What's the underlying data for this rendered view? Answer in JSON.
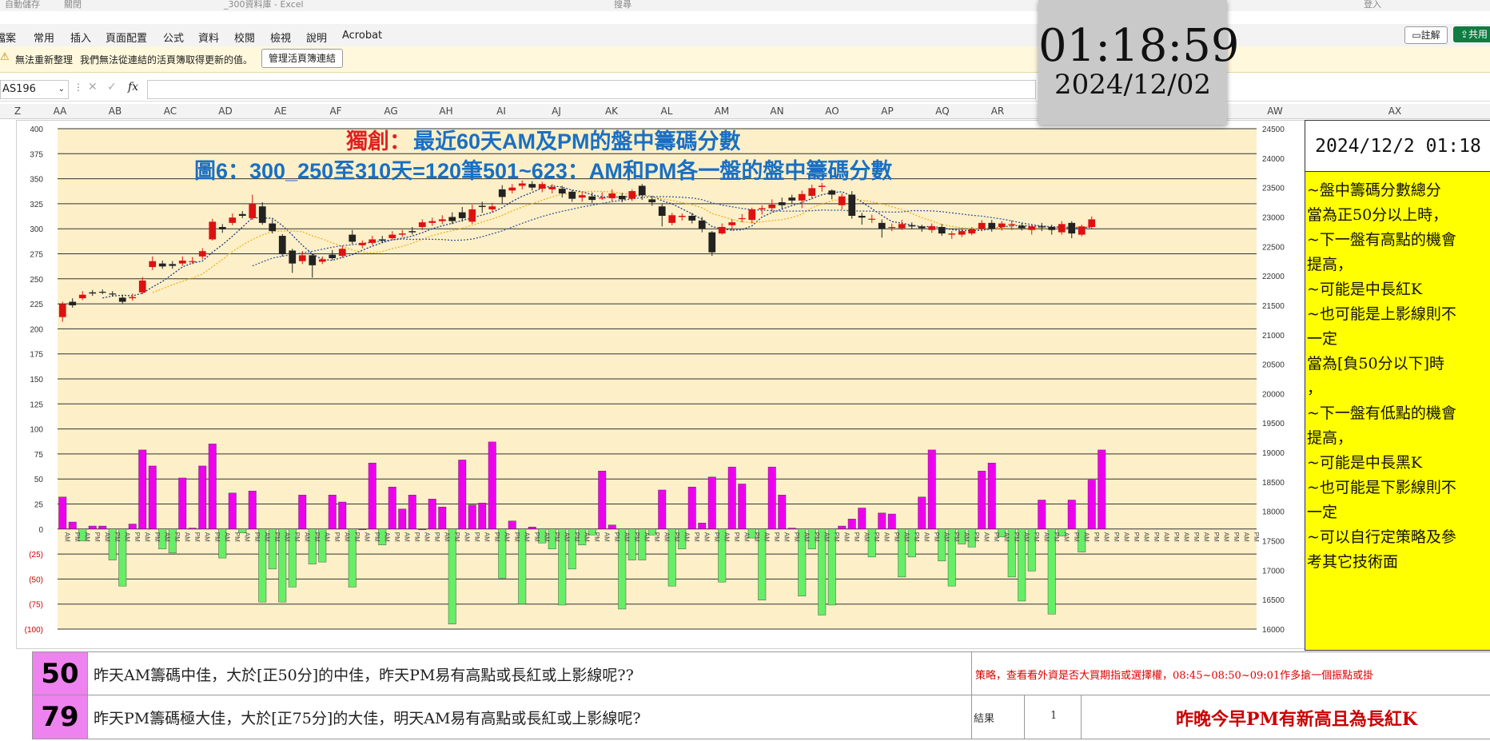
{
  "titlebar": {
    "autosave_label": "自動儲存",
    "autosave_state": "關閉",
    "filename": "_300資料庫 - Excel",
    "search_placeholder": "搜尋",
    "signin_label": "登入"
  },
  "menu": {
    "items": [
      "檔案",
      "常用",
      "插入",
      "頁面配置",
      "公式",
      "資料",
      "校閱",
      "檢視",
      "說明",
      "Acrobat"
    ],
    "comments_label": "註解",
    "share_label": "共用"
  },
  "message_bar": {
    "title": "無法重新整理",
    "text": "我們無法從連結的活頁簿取得更新的值。",
    "button_label": "管理活頁簿連結"
  },
  "formula_bar": {
    "name_box": "AS196",
    "fx_label": "fx",
    "formula": ""
  },
  "column_headers": [
    "Z",
    "AA",
    "AB",
    "AC",
    "AD",
    "AE",
    "AF",
    "AG",
    "AH",
    "AI",
    "AJ",
    "AK",
    "AL",
    "AM",
    "AN",
    "AO",
    "AP",
    "AQ",
    "AR",
    "AW",
    "AX"
  ],
  "clock": {
    "time": "01:18:59",
    "date": "2024/12/02"
  },
  "chart_data": {
    "type": "candlestick",
    "title_prefix": "獨創：",
    "title": "最近60天AM及PM的盤中籌碼分數",
    "subtitle": "圖6：300_250至310天=120筆501~623：AM和PM各一盤的盤中籌碼分數",
    "left_axis_ticks": [
      "400",
      "375",
      "350",
      "325",
      "300",
      "275",
      "250",
      "225",
      "200",
      "175",
      "150",
      "125",
      "100",
      "75",
      "50",
      "25",
      "0",
      "(25)",
      "(50)",
      "(75)",
      "(100)"
    ],
    "right_axis_ticks": [
      "24500",
      "24000",
      "23500",
      "23000",
      "22500",
      "22000",
      "21500",
      "21000",
      "20500",
      "20000",
      "19500",
      "19000",
      "18500",
      "18000",
      "17500",
      "17000",
      "16500",
      "16000"
    ],
    "ylim_left": [
      -100,
      400
    ],
    "ylim_right": [
      16000,
      24500
    ],
    "grid": true,
    "scores": [
      32,
      7,
      -12,
      3,
      3,
      -31,
      -57,
      5,
      79,
      63,
      -20,
      -24,
      51,
      1,
      63,
      85,
      -29,
      36,
      -4,
      38,
      -73,
      -40,
      -73,
      -58,
      34,
      -35,
      -33,
      34,
      27,
      -58,
      0,
      66,
      -16,
      42,
      20,
      34,
      0,
      30,
      22,
      -95,
      69,
      24,
      26,
      87,
      -49,
      8,
      -75,
      2,
      -14,
      -20,
      -76,
      -40,
      -16,
      -6,
      58,
      4,
      -80,
      -31,
      -31,
      -6,
      39,
      -57,
      -20,
      42,
      6,
      52,
      -53,
      62,
      45,
      -9,
      -71,
      62,
      34,
      1,
      -67,
      -20,
      -86,
      -76,
      3,
      10,
      21,
      -28,
      16,
      15,
      -48,
      -28,
      32,
      79,
      -32,
      -57,
      -15,
      -18,
      58,
      66,
      -8,
      -48,
      -72,
      -42,
      29,
      -85,
      -7,
      29,
      -23,
      49,
      79
    ],
    "price_candles": [
      [
        21300,
        21520,
        21560,
        21220
      ],
      [
        21560,
        21500,
        21620,
        21460
      ],
      [
        21620,
        21680,
        21740,
        21590
      ],
      [
        21720,
        21700,
        21760,
        21660
      ],
      [
        21730,
        21720,
        21770,
        21690
      ],
      [
        21700,
        21690,
        21740,
        21650
      ],
      [
        21630,
        21560,
        21680,
        21530
      ],
      [
        21620,
        21640,
        21700,
        21580
      ],
      [
        21720,
        21920,
        21980,
        21690
      ],
      [
        22150,
        22250,
        22330,
        22100
      ],
      [
        22210,
        22160,
        22260,
        22120
      ],
      [
        22200,
        22170,
        22250,
        22120
      ],
      [
        22210,
        22260,
        22330,
        22170
      ],
      [
        22250,
        22250,
        22320,
        22200
      ],
      [
        22330,
        22420,
        22470,
        22280
      ],
      [
        22620,
        22920,
        22970,
        22600
      ],
      [
        22830,
        22790,
        22880,
        22730
      ],
      [
        22900,
        22990,
        23060,
        22860
      ],
      [
        23050,
        23020,
        23100,
        22980
      ],
      [
        22980,
        23220,
        23380,
        22950
      ],
      [
        23180,
        22900,
        23250,
        22870
      ],
      [
        22890,
        22760,
        22960,
        22720
      ],
      [
        22680,
        22370,
        22710,
        22330
      ],
      [
        22430,
        22210,
        22460,
        22050
      ],
      [
        22250,
        22350,
        22420,
        22200
      ],
      [
        22350,
        22180,
        22380,
        21970
      ],
      [
        22240,
        22280,
        22330,
        22200
      ],
      [
        22360,
        22300,
        22440,
        22270
      ],
      [
        22340,
        22460,
        22510,
        22310
      ],
      [
        22700,
        22580,
        22780,
        22540
      ],
      [
        22520,
        22560,
        22600,
        22470
      ],
      [
        22560,
        22620,
        22680,
        22520
      ],
      [
        22620,
        22600,
        22680,
        22560
      ],
      [
        22640,
        22700,
        22760,
        22610
      ],
      [
        22700,
        22720,
        22780,
        22660
      ],
      [
        22760,
        22740,
        22830,
        22700
      ],
      [
        22830,
        22910,
        22960,
        22780
      ],
      [
        22900,
        22930,
        22990,
        22850
      ],
      [
        22930,
        22960,
        23030,
        22880
      ],
      [
        23000,
        22930,
        23080,
        22880
      ],
      [
        23080,
        22980,
        23170,
        22920
      ],
      [
        22920,
        23130,
        23210,
        22880
      ],
      [
        23190,
        23170,
        23260,
        23070
      ],
      [
        23130,
        23180,
        23240,
        23080
      ],
      [
        23470,
        23340,
        23540,
        23220
      ],
      [
        23450,
        23500,
        23560,
        23400
      ],
      [
        23530,
        23570,
        23620,
        23470
      ],
      [
        23560,
        23500,
        23610,
        23450
      ],
      [
        23480,
        23560,
        23600,
        23420
      ],
      [
        23470,
        23510,
        23560,
        23400
      ],
      [
        23480,
        23400,
        23530,
        23330
      ],
      [
        23430,
        23310,
        23460,
        23260
      ],
      [
        23330,
        23370,
        23420,
        23260
      ],
      [
        23350,
        23290,
        23420,
        23240
      ],
      [
        23330,
        23330,
        23420,
        23290
      ],
      [
        23320,
        23400,
        23470,
        23260
      ],
      [
        23360,
        23300,
        23410,
        23250
      ],
      [
        23310,
        23440,
        23470,
        23270
      ],
      [
        23530,
        23370,
        23560,
        23290
      ],
      [
        23300,
        23250,
        23350,
        23190
      ],
      [
        23180,
        23020,
        23220,
        22840
      ],
      [
        22900,
        23030,
        23070,
        22860
      ],
      [
        23000,
        23020,
        23060,
        22940
      ],
      [
        23020,
        22940,
        23070,
        22890
      ],
      [
        22940,
        22800,
        23000,
        22740
      ],
      [
        22740,
        22400,
        22760,
        22340
      ],
      [
        22720,
        22830,
        22890,
        22700
      ],
      [
        22860,
        22910,
        22960,
        22770
      ],
      [
        22970,
        22980,
        23050,
        22910
      ],
      [
        22950,
        23130,
        23160,
        22890
      ],
      [
        23130,
        23150,
        23200,
        23040
      ],
      [
        23150,
        23210,
        23300,
        23090
      ],
      [
        23250,
        23200,
        23330,
        23140
      ],
      [
        23330,
        23280,
        23380,
        23230
      ],
      [
        23280,
        23390,
        23450,
        23150
      ],
      [
        23360,
        23490,
        23550,
        23300
      ],
      [
        23510,
        23530,
        23580,
        23430
      ],
      [
        23450,
        23380,
        23470,
        23300
      ],
      [
        23200,
        23350,
        23400,
        23130
      ],
      [
        23380,
        23020,
        23440,
        22970
      ],
      [
        23020,
        22990,
        23070,
        22870
      ],
      [
        22960,
        22970,
        23040,
        22900
      ],
      [
        22900,
        22800,
        22960,
        22650
      ],
      [
        22820,
        22830,
        22890,
        22760
      ],
      [
        22810,
        22880,
        22950,
        22780
      ],
      [
        22860,
        22840,
        22910,
        22790
      ],
      [
        22840,
        22810,
        22870,
        22750
      ],
      [
        22780,
        22840,
        22890,
        22730
      ],
      [
        22830,
        22720,
        22880,
        22680
      ],
      [
        22700,
        22720,
        22760,
        22630
      ],
      [
        22700,
        22760,
        22800,
        22660
      ],
      [
        22720,
        22790,
        22830,
        22690
      ],
      [
        22800,
        22900,
        22950,
        22760
      ],
      [
        22900,
        22800,
        22950,
        22750
      ],
      [
        22830,
        22890,
        22930,
        22770
      ],
      [
        22870,
        22880,
        22940,
        22780
      ],
      [
        22850,
        22810,
        22900,
        22770
      ],
      [
        22780,
        22840,
        22880,
        22700
      ],
      [
        22840,
        22830,
        22900,
        22760
      ],
      [
        22830,
        22780,
        22870,
        22700
      ],
      [
        22740,
        22880,
        22930,
        22700
      ],
      [
        22900,
        22720,
        22930,
        22640
      ],
      [
        22700,
        22840,
        22870,
        22670
      ],
      [
        22830,
        22960,
        23010,
        22790
      ]
    ],
    "x_tick_labels_pattern": [
      "AM",
      "PM"
    ],
    "x_tick_count": 120
  },
  "side_panel": {
    "datetime": "2024/12/2 01:18",
    "lines": [
      "~盤中籌碼分數總分",
      "",
      "當為正50分以上時，",
      "~下一盤有高點的機會",
      "提高，",
      "~可能是中長紅K",
      "~也可能是上影線則不",
      "一定",
      "",
      "當為[負50分以下]時",
      "，",
      "~下一盤有低點的機會",
      "提高，",
      "~可能是中長黑K",
      "~也可能是下影線則不",
      "一定",
      "",
      "~可以自行定策略及參",
      "考其它技術面"
    ]
  },
  "rows": [
    {
      "score": "50",
      "text": "昨天AM籌碼中佳，大於[正50分]的中佳，昨天PM易有高點或長紅或上影線呢??",
      "note": "策略，查看看外資是否大買期指或選擇權，08:45~08:50~09:01作多搶一個振點或掛"
    },
    {
      "score": "79",
      "text": "昨天PM籌碼極大佳，大於[正75分]的大佳，明天AM易有高點或長紅或上影線呢?",
      "result_label": "結果",
      "result_value": "1",
      "result_text": "昨晚今早PM有新高且為長紅K"
    }
  ],
  "colors": {
    "plot_bg": "#fdf0c8",
    "positive_bar": "#ee00ee",
    "negative_bar": "#66ee66",
    "up_candle": "#dd1111",
    "down_candle": "#222222",
    "title_red": "#dd2222",
    "title_blue": "#1a6fc4",
    "side_panel_bg": "#ffff00",
    "result_red": "#cc0000"
  }
}
